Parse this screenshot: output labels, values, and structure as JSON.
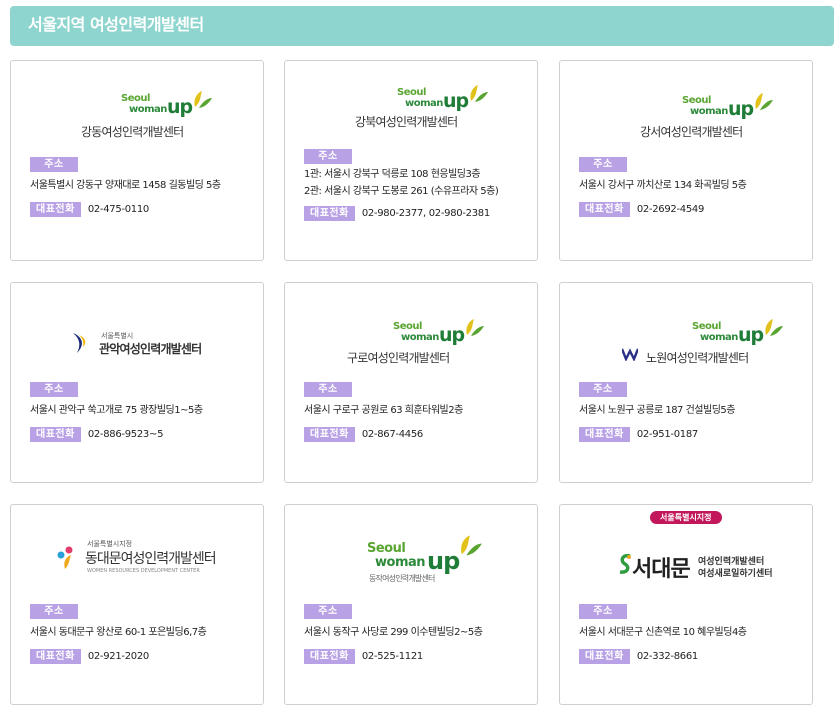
{
  "header": {
    "title": "서울지역 여성인력개발센터"
  },
  "labels": {
    "address": "주소",
    "phone": "대표전화"
  },
  "logo_text": {
    "seoul": "Seoul",
    "woman": "woman",
    "up": "up"
  },
  "centers": [
    {
      "name": "강동여성인력개발센터",
      "address_lines": [
        "서울특별시 강동구 양재대로 1458 길동빌딩 5층"
      ],
      "phone": "02-475-0110"
    },
    {
      "name": "강북여성인력개발센터",
      "address_lines": [
        "1관: 서울시 강북구 덕릉로 108 현응빌딩3층",
        "2관: 서울시 강북구 도봉로 261 (수유프라자 5층)"
      ],
      "phone": "02-980-2377, 02-980-2381"
    },
    {
      "name": "강서여성인력개발센터",
      "address_lines": [
        "서울시 강서구 까치산로 134 화곡빌딩 5층"
      ],
      "phone": "02-2692-4549"
    },
    {
      "name": "관악여성인력개발센터",
      "sub": "서울특별시",
      "address_lines": [
        "서울시 관악구 쑥고개로 75 광장빌딩1~5층"
      ],
      "phone": "02-886-9523~5"
    },
    {
      "name": "구로여성인력개발센터",
      "address_lines": [
        "서울시 구로구 공원로 63 희훈타워빌2층"
      ],
      "phone": "02-867-4456"
    },
    {
      "name": "노원여성인력개발센터",
      "address_lines": [
        "서울시 노원구 공릉로 187 건설빌딩5층"
      ],
      "phone": "02-951-0187"
    },
    {
      "name": "동대문여성인력개발센터",
      "sub": "서울특별시지정",
      "sub_en": "WOMEN RESOURCES DEVELOPMENT CENTER",
      "address_lines": [
        "서울시 동대문구 왕산로 60-1 포은빌딩6,7층"
      ],
      "phone": "02-921-2020"
    },
    {
      "name": "동작여성인력개발센터",
      "address_lines": [
        "서울시 동작구 사당로 299 이수텐빌딩2~5층"
      ],
      "phone": "02-525-1121"
    },
    {
      "name": "서대문",
      "badge": "서울특별시지정",
      "name_line1": "여성인력개발센터",
      "name_line2": "여성새로일하기센터",
      "address_lines": [
        "서울시 서대문구 신촌역로 10 혜우빌딩4층"
      ],
      "phone": "02-332-8661"
    }
  ],
  "colors": {
    "header_bg": "#8fd5cf",
    "tag_bg": "#b8a1e4",
    "logo_green": "#1f7d37",
    "leaf_yellow": "#e2c21a",
    "badge_pink": "#c2185b"
  }
}
